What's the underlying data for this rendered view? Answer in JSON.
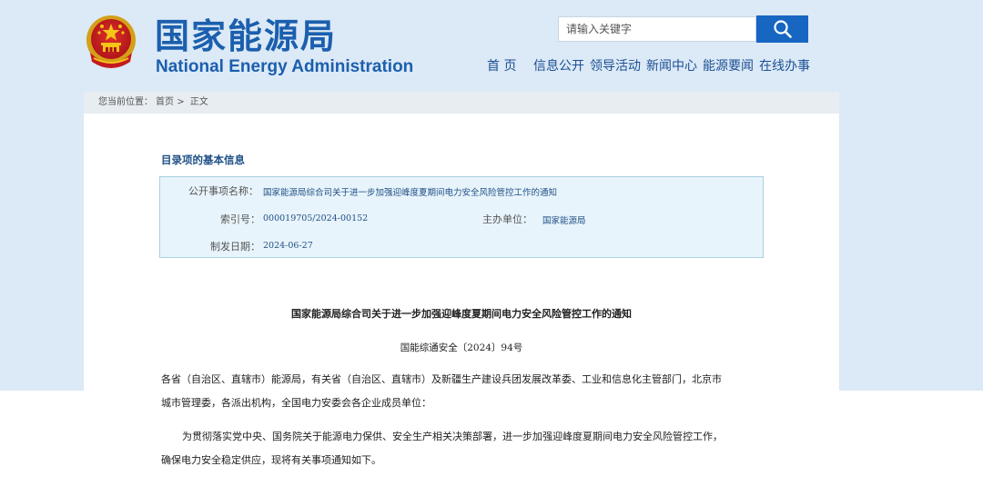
{
  "header": {
    "site_name_cn": "国家能源局",
    "site_name_en": "National Energy Administration",
    "search_placeholder": "请输入关键字",
    "nav": [
      "首 页",
      "信息公开",
      "领导活动",
      "新闻中心",
      "能源要闻",
      "在线办事"
    ]
  },
  "breadcrumb": {
    "prefix": "您当前位置：",
    "home": "首页",
    "separator": ">",
    "current": "正文"
  },
  "info": {
    "heading": "目录项的基本信息",
    "subject_label": "公开事项名称：",
    "subject_value": "国家能源局综合司关于进一步加强迎峰度夏期间电力安全风险管控工作的通知",
    "index_label": "索引号：",
    "index_value": "000019705/2024-00152",
    "host_label": "主办单位：",
    "host_value": "国家能源局",
    "date_label": "制发日期：",
    "date_value": "2024-06-27"
  },
  "document": {
    "title": "国家能源局综合司关于进一步加强迎峰度夏期间电力安全风险管控工作的通知",
    "number": "国能综通安全〔2024〕94号",
    "recipients_line1": "各省（自治区、直辖市）能源局，有关省（自治区、直辖市）及新疆生产建设兵团发展改革委、工业和信息化主管部门，北京市",
    "recipients_line2": "城市管理委，各派出机构，全国电力安委会各企业成员单位：",
    "body_line1": "为贯彻落实党中央、国务院关于能源电力保供、安全生产相关决策部署，进一步加强迎峰度夏期间电力安全风险管控工作，",
    "body_line2": "确保电力安全稳定供应，现将有关事项通知如下。"
  },
  "colors": {
    "brand_blue": "#1b5fae",
    "search_button": "#1766c2",
    "page_background": "#dce9f6",
    "info_box": "#e8f4fb"
  },
  "icons": {
    "emblem": "national-emblem-icon",
    "search": "search-icon"
  }
}
